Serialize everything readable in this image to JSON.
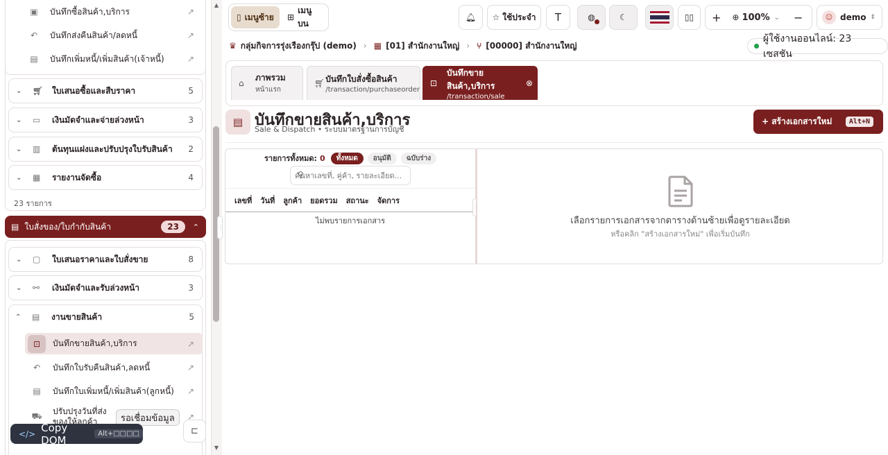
{
  "sidebar": {
    "top_items": [
      {
        "label": "บันทึกซื้อสินค้า,บริการ",
        "icon": "box-icon"
      },
      {
        "label": "บันทึกส่งคืนสินค้า/ลดหนี้",
        "icon": "undo-icon"
      },
      {
        "label": "บันทึกเพิ่มหนี้/เพิ่มสินค้า(เจ้าหนี้)",
        "icon": "document-icon"
      }
    ],
    "purchase_categories": [
      {
        "label": "ใบเสนอซื้อและสืบราคา",
        "count": "5",
        "icon": "cart-icon"
      },
      {
        "label": "เงินมัดจำและจ่ายล่วงหน้า",
        "count": "3",
        "icon": "card-icon"
      },
      {
        "label": "ต้นทุนแฝงและปรับปรุงใบรับสินค้า",
        "count": "2",
        "icon": "clipboard-icon"
      },
      {
        "label": "รายงานจัดซื้อ",
        "count": "4",
        "icon": "bar-chart-icon"
      }
    ],
    "purchase_total": "23 รายการ",
    "sales_section": {
      "label": "ใบสั่งของ/ใบกำกับสินค้า",
      "count": "23"
    },
    "sales_categories": [
      {
        "label": "ใบเสนอราคาและใบสั่งขาย",
        "count": "8",
        "icon": "folder-icon"
      },
      {
        "label": "เงินมัดจำและรับล่วงหน้า",
        "count": "3",
        "icon": "handshake-icon"
      },
      {
        "label": "งานขายสินค้า",
        "count": "5",
        "icon": "list-icon"
      }
    ],
    "sales_items": [
      {
        "label": "บันทึกขายสินค้า,บริการ",
        "icon": "register-icon",
        "active": true
      },
      {
        "label": "บันทึกใบรับคืนสินค้า,ลดหนี้",
        "icon": "undo-icon"
      },
      {
        "label": "บันทึกใบเพิ่มหนี้/เพิ่มสินค้า(ลูกหนี้)",
        "icon": "document-icon"
      },
      {
        "label": "ปรับปรุงวันที่ส่งของให้ลูกค้า",
        "icon": "truck-icon"
      }
    ],
    "wait_badge": "รอเชื่อมข้อมูล",
    "copy_dom": {
      "label": "Copy DOM",
      "shortcut": "Alt+□□□□"
    }
  },
  "topbar": {
    "menu_left": "เมนูซ้าย",
    "menu_top": "เมนูบน",
    "favorites": "ใช้ประจำ",
    "font_button": "T",
    "zoom": "100%"
  },
  "user": {
    "name": "demo"
  },
  "breadcrumb": {
    "company": "กลุ่มกิจการรุ่งเรืองกรุ๊ป (demo)",
    "branch": "[01] สำนักงานใหญ่",
    "sub_branch": "[00000] สำนักงานใหญ่"
  },
  "online": "ผู้ใช้งานออนไลน์: 23 เซสชัน",
  "tabs": [
    {
      "title": "ภาพรวม",
      "sub": "หน้าแรก"
    },
    {
      "title": "บันทึกใบสั่งซื้อสินค้า",
      "sub": "/transaction/purchaseorder"
    },
    {
      "title": "บันทึกขาย",
      "title2": "สินค้า,บริการ",
      "sub": "/transaction/sale"
    }
  ],
  "page": {
    "title": "บันทึกขายสินค้า,บริการ",
    "subtitle": "Sale & Dispatch • ระบบมาตรฐานการบัญชี",
    "create_label": "+ สร้างเอกสารใหม่",
    "create_shortcut": "Alt+N"
  },
  "list": {
    "summary_label": "รายการทั้งหมด:",
    "summary_count": "0",
    "filters": [
      "ทั้งหมด",
      "อนุมัติ",
      "ฉบับร่าง"
    ],
    "search_placeholder": "ค้นหาเลขที่, คู่ค้า, รายละเอียด...",
    "columns": [
      "เลขที่",
      "วันที่",
      "ลูกค้า",
      "ยอดรวม",
      "สถานะ",
      "จัดการ"
    ],
    "empty": "ไม่พบรายการเอกสาร"
  },
  "detail": {
    "message": "เลือกรายการเอกสารจากตารางด้านซ้ายเพื่อดูรายละเอียด",
    "hint": "หรือคลิก \"สร้างเอกสารใหม่\" เพื่อเริ่มบันทึก"
  },
  "colors": {
    "brand": "#7a1f1f",
    "online": "#22a04a"
  }
}
